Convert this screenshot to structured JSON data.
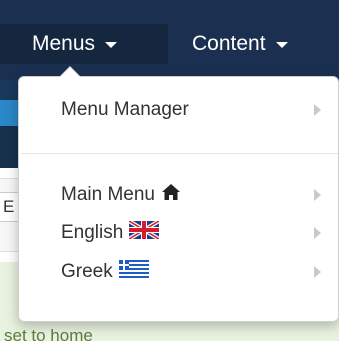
{
  "navbar": {
    "menus_label": "Menus",
    "content_label": "Content"
  },
  "background": {
    "partial_button_text": "E",
    "bottom_text": "set to home"
  },
  "dropdown": {
    "items": [
      {
        "label": "Menu Manager",
        "icon": ""
      },
      {
        "label": "Main Menu",
        "icon": "home-icon"
      },
      {
        "label": "English",
        "icon": "uk-flag-icon"
      },
      {
        "label": "Greek",
        "icon": "greek-flag-icon"
      }
    ]
  },
  "colors": {
    "navbar": "#1b3050",
    "active_nav": "#15263f",
    "accent_blue": "#2a87c8",
    "success_bg": "#e8f2df"
  }
}
